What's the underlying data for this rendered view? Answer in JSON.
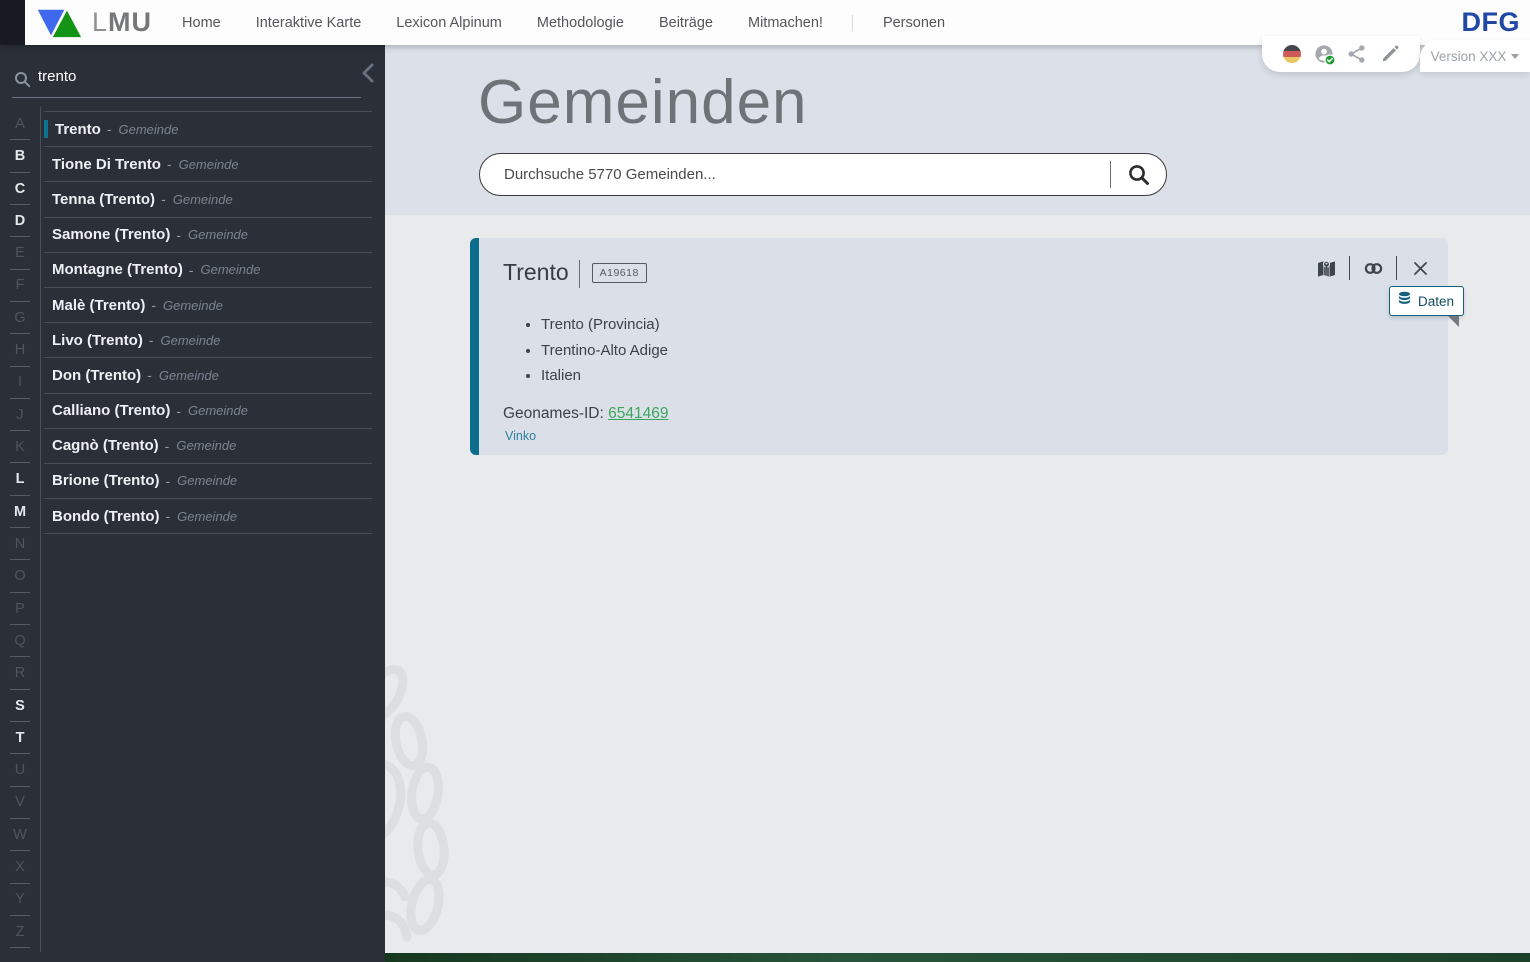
{
  "brand": {
    "lmu_l": "L",
    "lmu_mu": "MU",
    "dfg": "DFG"
  },
  "nav": {
    "items": [
      {
        "label": "Home"
      },
      {
        "label": "Interaktive Karte"
      },
      {
        "label": "Lexicon Alpinum"
      },
      {
        "label": "Methodologie"
      },
      {
        "label": "Beiträge"
      },
      {
        "label": "Mitmachen!"
      },
      {
        "label": "Personen",
        "divided": true
      }
    ]
  },
  "quickbar": {
    "version_label": "Version XXX"
  },
  "sidebar": {
    "search_value": "trento",
    "result_separator": "-",
    "letters": [
      {
        "ch": "A",
        "active": false
      },
      {
        "ch": "B",
        "active": true
      },
      {
        "ch": "C",
        "active": true
      },
      {
        "ch": "D",
        "active": true
      },
      {
        "ch": "E",
        "active": false
      },
      {
        "ch": "F",
        "active": false
      },
      {
        "ch": "G",
        "active": false
      },
      {
        "ch": "H",
        "active": false
      },
      {
        "ch": "I",
        "active": false
      },
      {
        "ch": "J",
        "active": false
      },
      {
        "ch": "K",
        "active": false
      },
      {
        "ch": "L",
        "active": true
      },
      {
        "ch": "M",
        "active": true
      },
      {
        "ch": "N",
        "active": false
      },
      {
        "ch": "O",
        "active": false
      },
      {
        "ch": "P",
        "active": false
      },
      {
        "ch": "Q",
        "active": false
      },
      {
        "ch": "R",
        "active": false
      },
      {
        "ch": "S",
        "active": true
      },
      {
        "ch": "T",
        "active": true
      },
      {
        "ch": "U",
        "active": false
      },
      {
        "ch": "V",
        "active": false
      },
      {
        "ch": "W",
        "active": false
      },
      {
        "ch": "X",
        "active": false
      },
      {
        "ch": "Y",
        "active": false
      },
      {
        "ch": "Z",
        "active": false
      }
    ],
    "results": [
      {
        "name": "Trento",
        "type": "Gemeinde",
        "selected": true
      },
      {
        "name": "Tione Di Trento",
        "type": "Gemeinde"
      },
      {
        "name": "Tenna (Trento)",
        "type": "Gemeinde"
      },
      {
        "name": "Samone (Trento)",
        "type": "Gemeinde"
      },
      {
        "name": "Montagne (Trento)",
        "type": "Gemeinde"
      },
      {
        "name": "Malè (Trento)",
        "type": "Gemeinde"
      },
      {
        "name": "Livo (Trento)",
        "type": "Gemeinde"
      },
      {
        "name": "Don (Trento)",
        "type": "Gemeinde"
      },
      {
        "name": "Calliano (Trento)",
        "type": "Gemeinde"
      },
      {
        "name": "Cagnò (Trento)",
        "type": "Gemeinde"
      },
      {
        "name": "Brione (Trento)",
        "type": "Gemeinde"
      },
      {
        "name": "Bondo (Trento)",
        "type": "Gemeinde"
      }
    ]
  },
  "main": {
    "title": "Gemeinden",
    "search_placeholder": "Durchsuche 5770 Gemeinden..."
  },
  "card": {
    "title": "Trento",
    "badge": "A19618",
    "tooltip_label": "Daten",
    "bullets": [
      "Trento (Provincia)",
      "Trentino-Alto Adige",
      "Italien"
    ],
    "geonames_label": "Geonames-ID:",
    "geonames_id": "6541469",
    "footer_link": "Vinko"
  },
  "colors": {
    "accent_teal": "#0c6c8c",
    "link_green": "#3da65e",
    "dfg_blue": "#2149a4",
    "sidebar_bg": "#2b2f38"
  }
}
